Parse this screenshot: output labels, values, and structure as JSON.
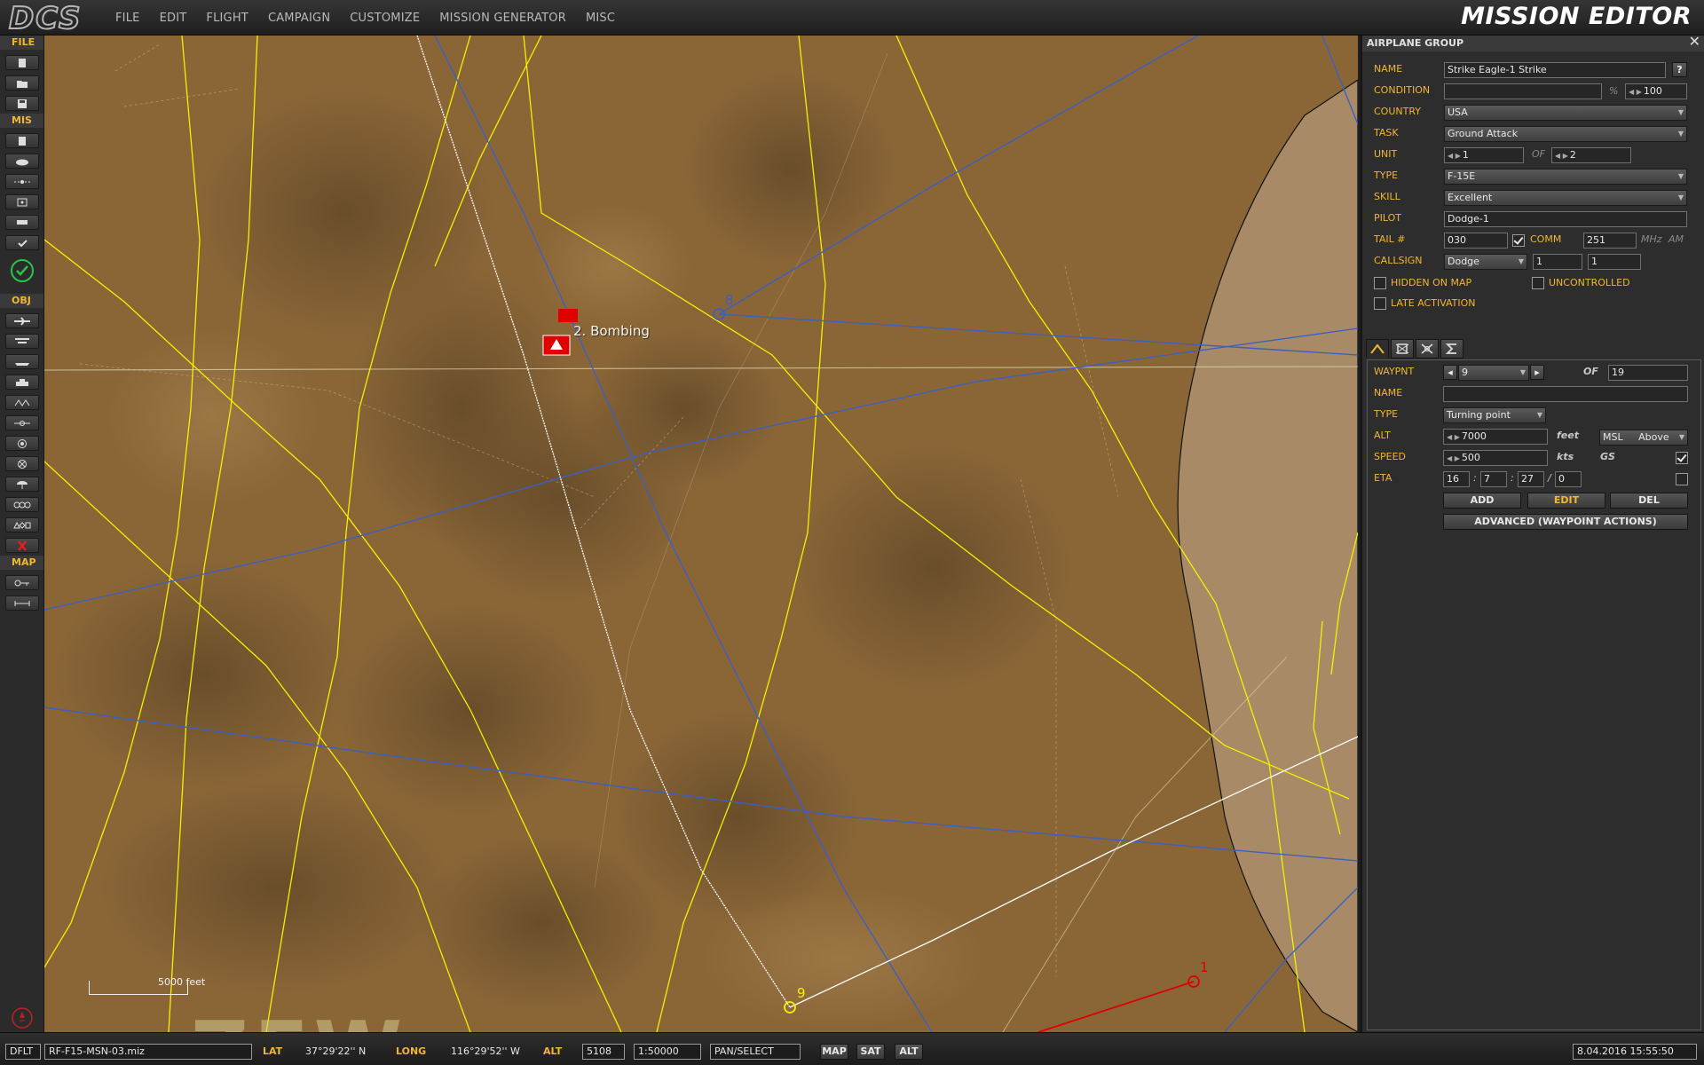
{
  "app": {
    "logo_text": "DCS",
    "title": "MISSION EDITOR"
  },
  "menu": [
    "FILE",
    "EDIT",
    "FLIGHT",
    "CAMPAIGN",
    "CUSTOMIZE",
    "MISSION GENERATOR",
    "MISC"
  ],
  "toolbar": {
    "sections": [
      "FILE",
      "MIS",
      "OBJ",
      "MAP"
    ]
  },
  "map": {
    "target_label": "2. Bombing",
    "waypoints": [
      "8",
      "9",
      "1"
    ],
    "scale_label": "5000 feet",
    "grid_label": "ZEW",
    "colors": {
      "terrain": "#8a6637",
      "route": "#f2f200",
      "blue_route": "#3d5fc0",
      "red": "#e00000",
      "white_route": "#ffffff"
    }
  },
  "panel": {
    "header": "AIRPLANE GROUP",
    "help": "?",
    "labels": {
      "name": "NAME",
      "condition": "CONDITION",
      "country": "COUNTRY",
      "task": "TASK",
      "unit": "UNIT",
      "type": "TYPE",
      "skill": "SKILL",
      "pilot": "PILOT",
      "tail": "TAIL #",
      "callsign": "CALLSIGN",
      "comm": "COMM",
      "of": "OF",
      "hidden": "HIDDEN ON MAP",
      "uncontrolled": "UNCONTROLLED",
      "late": "LATE ACTIVATION",
      "pct": "%",
      "mhz": "MHz",
      "am": "AM"
    },
    "values": {
      "name": "Strike Eagle-1 Strike",
      "condition": "",
      "condition_pct": "100",
      "country": "USA",
      "task": "Ground Attack",
      "unit": "1",
      "unit_of": "2",
      "type": "F-15E",
      "skill": "Excellent",
      "pilot": "Dodge-1",
      "tail": "030",
      "comm": "251",
      "callsign": "Dodge",
      "callsign_n1": "1",
      "callsign_n2": "1"
    },
    "checks": {
      "tail_comm": true,
      "hidden": false,
      "uncontrolled": false,
      "late": false
    },
    "waypoint": {
      "labels": {
        "waypnt": "WAYPNT",
        "of": "OF",
        "name": "NAME",
        "type": "TYPE",
        "alt": "ALT",
        "speed": "SPEED",
        "eta": "ETA"
      },
      "current": "9",
      "total": "19",
      "name": "",
      "type": "Turning point",
      "alt": "7000",
      "alt_unit": "feet",
      "alt_ref": "MSL",
      "alt_ref2": "Above",
      "speed": "500",
      "speed_unit": "kts",
      "speed_ref": "GS",
      "speed_locked": true,
      "eta": [
        "16",
        "7",
        "27",
        "0"
      ],
      "eta_locked": false,
      "buttons": {
        "add": "ADD",
        "edit": "EDIT",
        "del": "DEL",
        "advanced": "ADVANCED (WAYPOINT ACTIONS)"
      }
    }
  },
  "status": {
    "mode": "DFLT",
    "file": "RF-F15-MSN-03.miz",
    "lat_label": "LAT",
    "lat": "37°29'22'' N",
    "long_label": "LONG",
    "long": "116°29'52'' W",
    "alt_label": "ALT",
    "alt": "5108",
    "scale": "1:50000",
    "tool": "PAN/SELECT",
    "btn_map": "MAP",
    "btn_sat": "SAT",
    "btn_alt": "ALT",
    "datetime": "8.04.2016 15:55:50"
  }
}
